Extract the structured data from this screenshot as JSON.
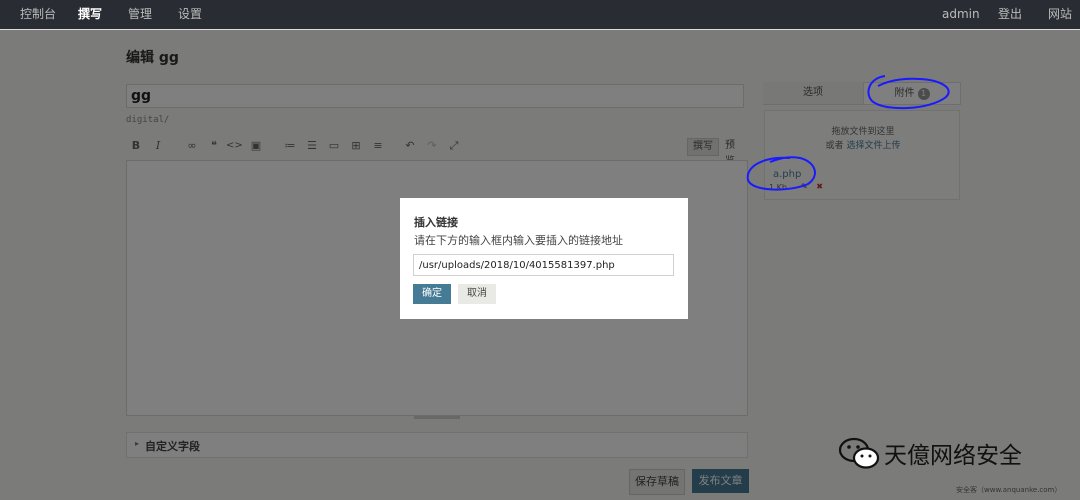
{
  "nav": {
    "items": [
      {
        "label": "控制台"
      },
      {
        "label": "撰写"
      },
      {
        "label": "管理"
      },
      {
        "label": "设置"
      }
    ],
    "user": "admin",
    "logout": "登出",
    "site": "网站"
  },
  "page": {
    "title": "编辑 gg"
  },
  "editor": {
    "title_value": "gg",
    "slug": "digital/",
    "toolbar": {
      "bold": "B",
      "italic": "I",
      "link": "∞",
      "quote": "❝",
      "code": "<>",
      "image": "▣",
      "ol": "≔",
      "ul": "☰",
      "hr": "▭",
      "more": "⊞",
      "misc": "≡",
      "undo": "↶",
      "redo": "↷",
      "fullscreen": "⤢",
      "write_tab": "撰写",
      "preview_tab": "预览"
    }
  },
  "custom_fields": {
    "arrow": "▸",
    "label": "自定义字段"
  },
  "actions": {
    "save_draft": "保存草稿",
    "publish": "发布文章"
  },
  "sidebar": {
    "tabs": [
      {
        "label": "选项"
      },
      {
        "label": "附件"
      }
    ],
    "attach_count": "1",
    "drop_hint": "拖放文件到这里",
    "or_text": "或者",
    "select_file": "选择文件上传",
    "file": {
      "name": "a.php",
      "size": "1 Kb",
      "edit_icon": "✎",
      "delete_icon": "✖"
    }
  },
  "modal": {
    "title": "插入链接",
    "desc": "请在下方的输入框内输入要插入的链接地址",
    "url": "/usr/uploads/2018/10/4015581397.php",
    "ok": "确定",
    "cancel": "取消"
  },
  "watermark": {
    "text": "天億网络安全",
    "source": "安全客（www.anquanke.com）"
  },
  "colors": {
    "nav_bg": "#292d33",
    "accent": "#467b96",
    "annotation": "#1a1aff"
  }
}
